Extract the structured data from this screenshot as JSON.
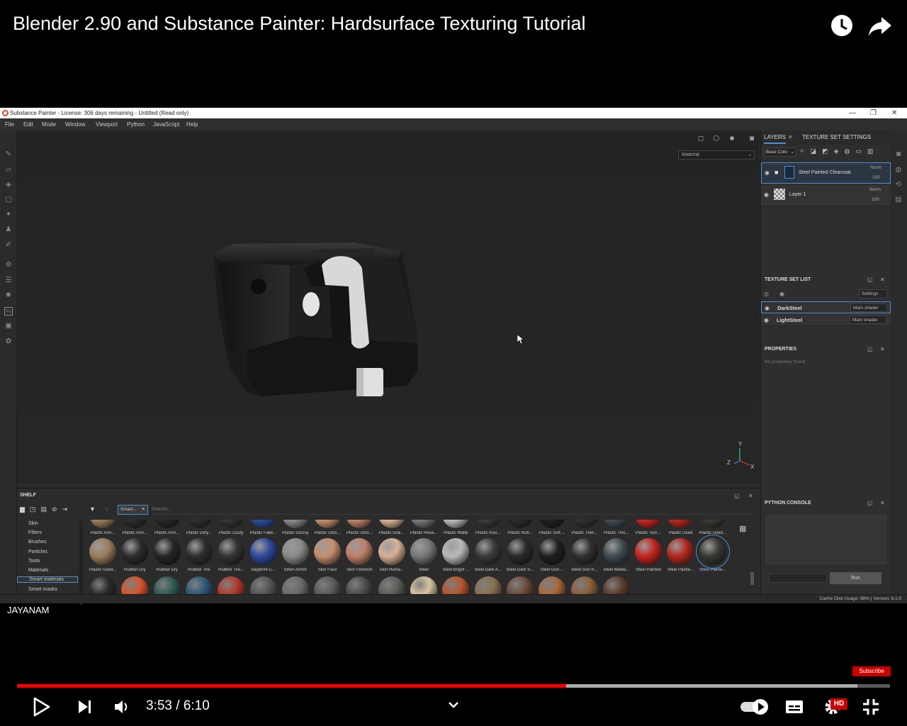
{
  "video": {
    "title": "Blender 2.90 and Substance Painter: Hardsurface Texturing Tutorial",
    "channel": "JAYANAM",
    "subscribe_label": "Subscribe",
    "time_current": "3:53",
    "time_separator": " / ",
    "time_total": "6:10",
    "progress_played": 0.629,
    "progress_buffered": 0.963,
    "hd_badge": "HD",
    "icons": [
      "watch-later-icon",
      "share-icon",
      "play-icon",
      "next-icon",
      "volume-icon",
      "chevron-down-icon",
      "autoplay-toggle-icon",
      "captions-icon",
      "settings-icon",
      "exit-fullscreen-icon"
    ]
  },
  "app": {
    "window_title": "Substance Painter - License: 306 days remaining - Untitled (Read only)",
    "menu": [
      "File",
      "Edit",
      "Mode",
      "Window",
      "Viewport",
      "Python",
      "JavaScript",
      "Help"
    ],
    "viewport": {
      "material_mode": "Material",
      "gizmo_x": "X",
      "gizmo_y": "Y",
      "gizmo_z": "Z"
    },
    "layers_panel": {
      "tab_layers": "LAYERS",
      "tab_texture_set_settings": "TEXTURE SET SETTINGS",
      "channel_select": "Base Colo",
      "layers": [
        {
          "name": "Steel Painted Clearcoat",
          "blend": "Norm",
          "opacity": "100"
        },
        {
          "name": "Layer 1",
          "blend": "Norm",
          "opacity": "100"
        }
      ]
    },
    "texture_set_list": {
      "title": "TEXTURE SET LIST",
      "settings_label": "Settings",
      "sets": [
        {
          "name": "DarkSteel",
          "shader": "Main shader"
        },
        {
          "name": "LightSteel",
          "shader": "Main shader"
        }
      ]
    },
    "properties": {
      "title": "PROPERTIES",
      "empty_text": "No properties found"
    },
    "python_console": {
      "title": "PYTHON CONSOLE",
      "run_label": "Run"
    },
    "shelf": {
      "title": "SHELF",
      "filter_tag": "Smart...",
      "search_placeholder": "Search...",
      "categories": [
        "Skin",
        "Filters",
        "Brushes",
        "Particles",
        "Tools",
        "Materials",
        "Smart materials",
        "Smart masks"
      ],
      "selected_category": "Smart materials",
      "row1_labels": [
        "Plastic Arm...",
        "Plastic Arm...",
        "Plastic Arm...",
        "Plastic Dirty...",
        "Plastic Dusty",
        "Plastic Fake...",
        "Plastic Glossy",
        "Plastic Glos...",
        "Plastic Glos...",
        "Plastic Grai...",
        "Plastic Hexa...",
        "Plastic Matte",
        "Plastic Rou...",
        "Plastic Rub...",
        "Plastic Soft ...",
        "Plastic Ther...",
        "Plastic Thic...",
        "Plastic Tool ...",
        "Plastic Used",
        "Plastic Used..."
      ],
      "row2_labels": [
        "Plastic Used...",
        "Rubber Dry",
        "Rubber Dry",
        "Rubber Tire",
        "Rubber Tire...",
        "Sapphire C...",
        "Silver Armor",
        "Skin Face",
        "Skin Feverish",
        "Skin Huma...",
        "Steel",
        "Steel Bright ...",
        "Steel Dark A...",
        "Steel Dark S...",
        "Steel Gun ...",
        "Steel Gun P...",
        "Steel Medie...",
        "Steel Painted",
        "Steel Painte...",
        "Steel Painte..."
      ],
      "row2_colors": [
        "#9a7d5c",
        "#2c2c2c",
        "#262626",
        "#2e2e2e",
        "#333",
        "#2e4aa0",
        "#8a8a88",
        "#c48f6c",
        "#c0806a",
        "#d9b094",
        "#777",
        "#b9b9b9",
        "#3a3a3a",
        "#2a2a2a",
        "#202020",
        "#303030",
        "#3e4a50",
        "#c8241e",
        "#b3281f",
        "#3a3834"
      ],
      "row3_colors": [
        "#2a2a2a",
        "#d8542c",
        "#2e5a54",
        "#2c5878",
        "#b5392c",
        "#555",
        "#6a6a6a",
        "#5a5a5a",
        "#4c4c4c",
        "#5a5e58",
        "#d8c4a0",
        "#b8562c",
        "#8a7050",
        "#6e4c3c",
        "#a8683c",
        "#8a603c",
        "#5a3c2c"
      ]
    },
    "status": {
      "cache": "Cache Disk Usage:   98% | Version: 6.1.0"
    }
  }
}
